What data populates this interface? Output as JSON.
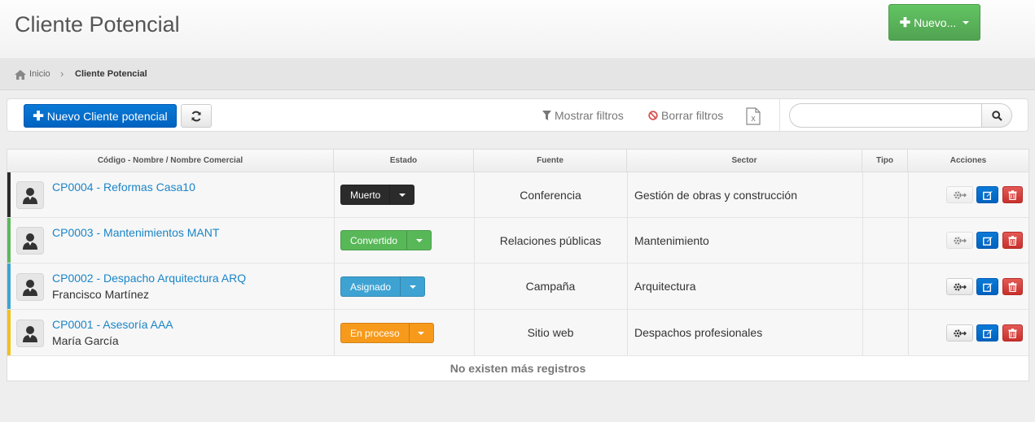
{
  "header": {
    "title": "Cliente Potencial",
    "new_button": "Nuevo..."
  },
  "breadcrumb": {
    "home": "Inicio",
    "current": "Cliente Potencial"
  },
  "toolbar": {
    "new_lead_button": "Nuevo Cliente potencial",
    "show_filters": "Mostrar filtros",
    "clear_filters": "Borrar filtros",
    "search_placeholder": ""
  },
  "table": {
    "columns": [
      "Código - Nombre / Nombre Comercial",
      "Estado",
      "Fuente",
      "Sector",
      "Tipo",
      "Acciones"
    ],
    "rows": [
      {
        "code_name": "CP0004 - Reformas Casa10",
        "contact": "",
        "status": "Muerto",
        "status_color": "#2b2b2b",
        "source": "Conferencia",
        "sector": "Gestión de obras y construcción",
        "type": "",
        "row_color": "#2b2b2b"
      },
      {
        "code_name": "CP0003 - Mantenimientos MANT",
        "contact": "",
        "status": "Convertido",
        "status_color": "#58b858",
        "source": "Relaciones públicas",
        "sector": "Mantenimiento",
        "type": "",
        "row_color": "#5cb85c"
      },
      {
        "code_name": "CP0002 - Despacho Arquitectura ARQ",
        "contact": "Francisco Martínez",
        "status": "Asignado",
        "status_color": "#3ea3d3",
        "source": "Campaña",
        "sector": "Arquitectura",
        "type": "",
        "row_color": "#3ea3d3"
      },
      {
        "code_name": "CP0001 - Asesoría AAA",
        "contact": "María García",
        "status": "En proceso",
        "status_color": "#f79a1b",
        "source": "Sitio web",
        "sector": "Despachos profesionales",
        "type": "",
        "row_color": "#f0c020"
      }
    ],
    "footer": "No existen más registros"
  },
  "icons": {
    "home": "home-icon",
    "refresh": "refresh-icon",
    "filter": "filter-icon",
    "clear": "ban-icon",
    "excel": "excel-icon",
    "search": "search-icon",
    "avatar": "user-avatar-icon",
    "convert": "convert-gear-icon",
    "edit": "edit-icon",
    "delete": "trash-icon"
  }
}
